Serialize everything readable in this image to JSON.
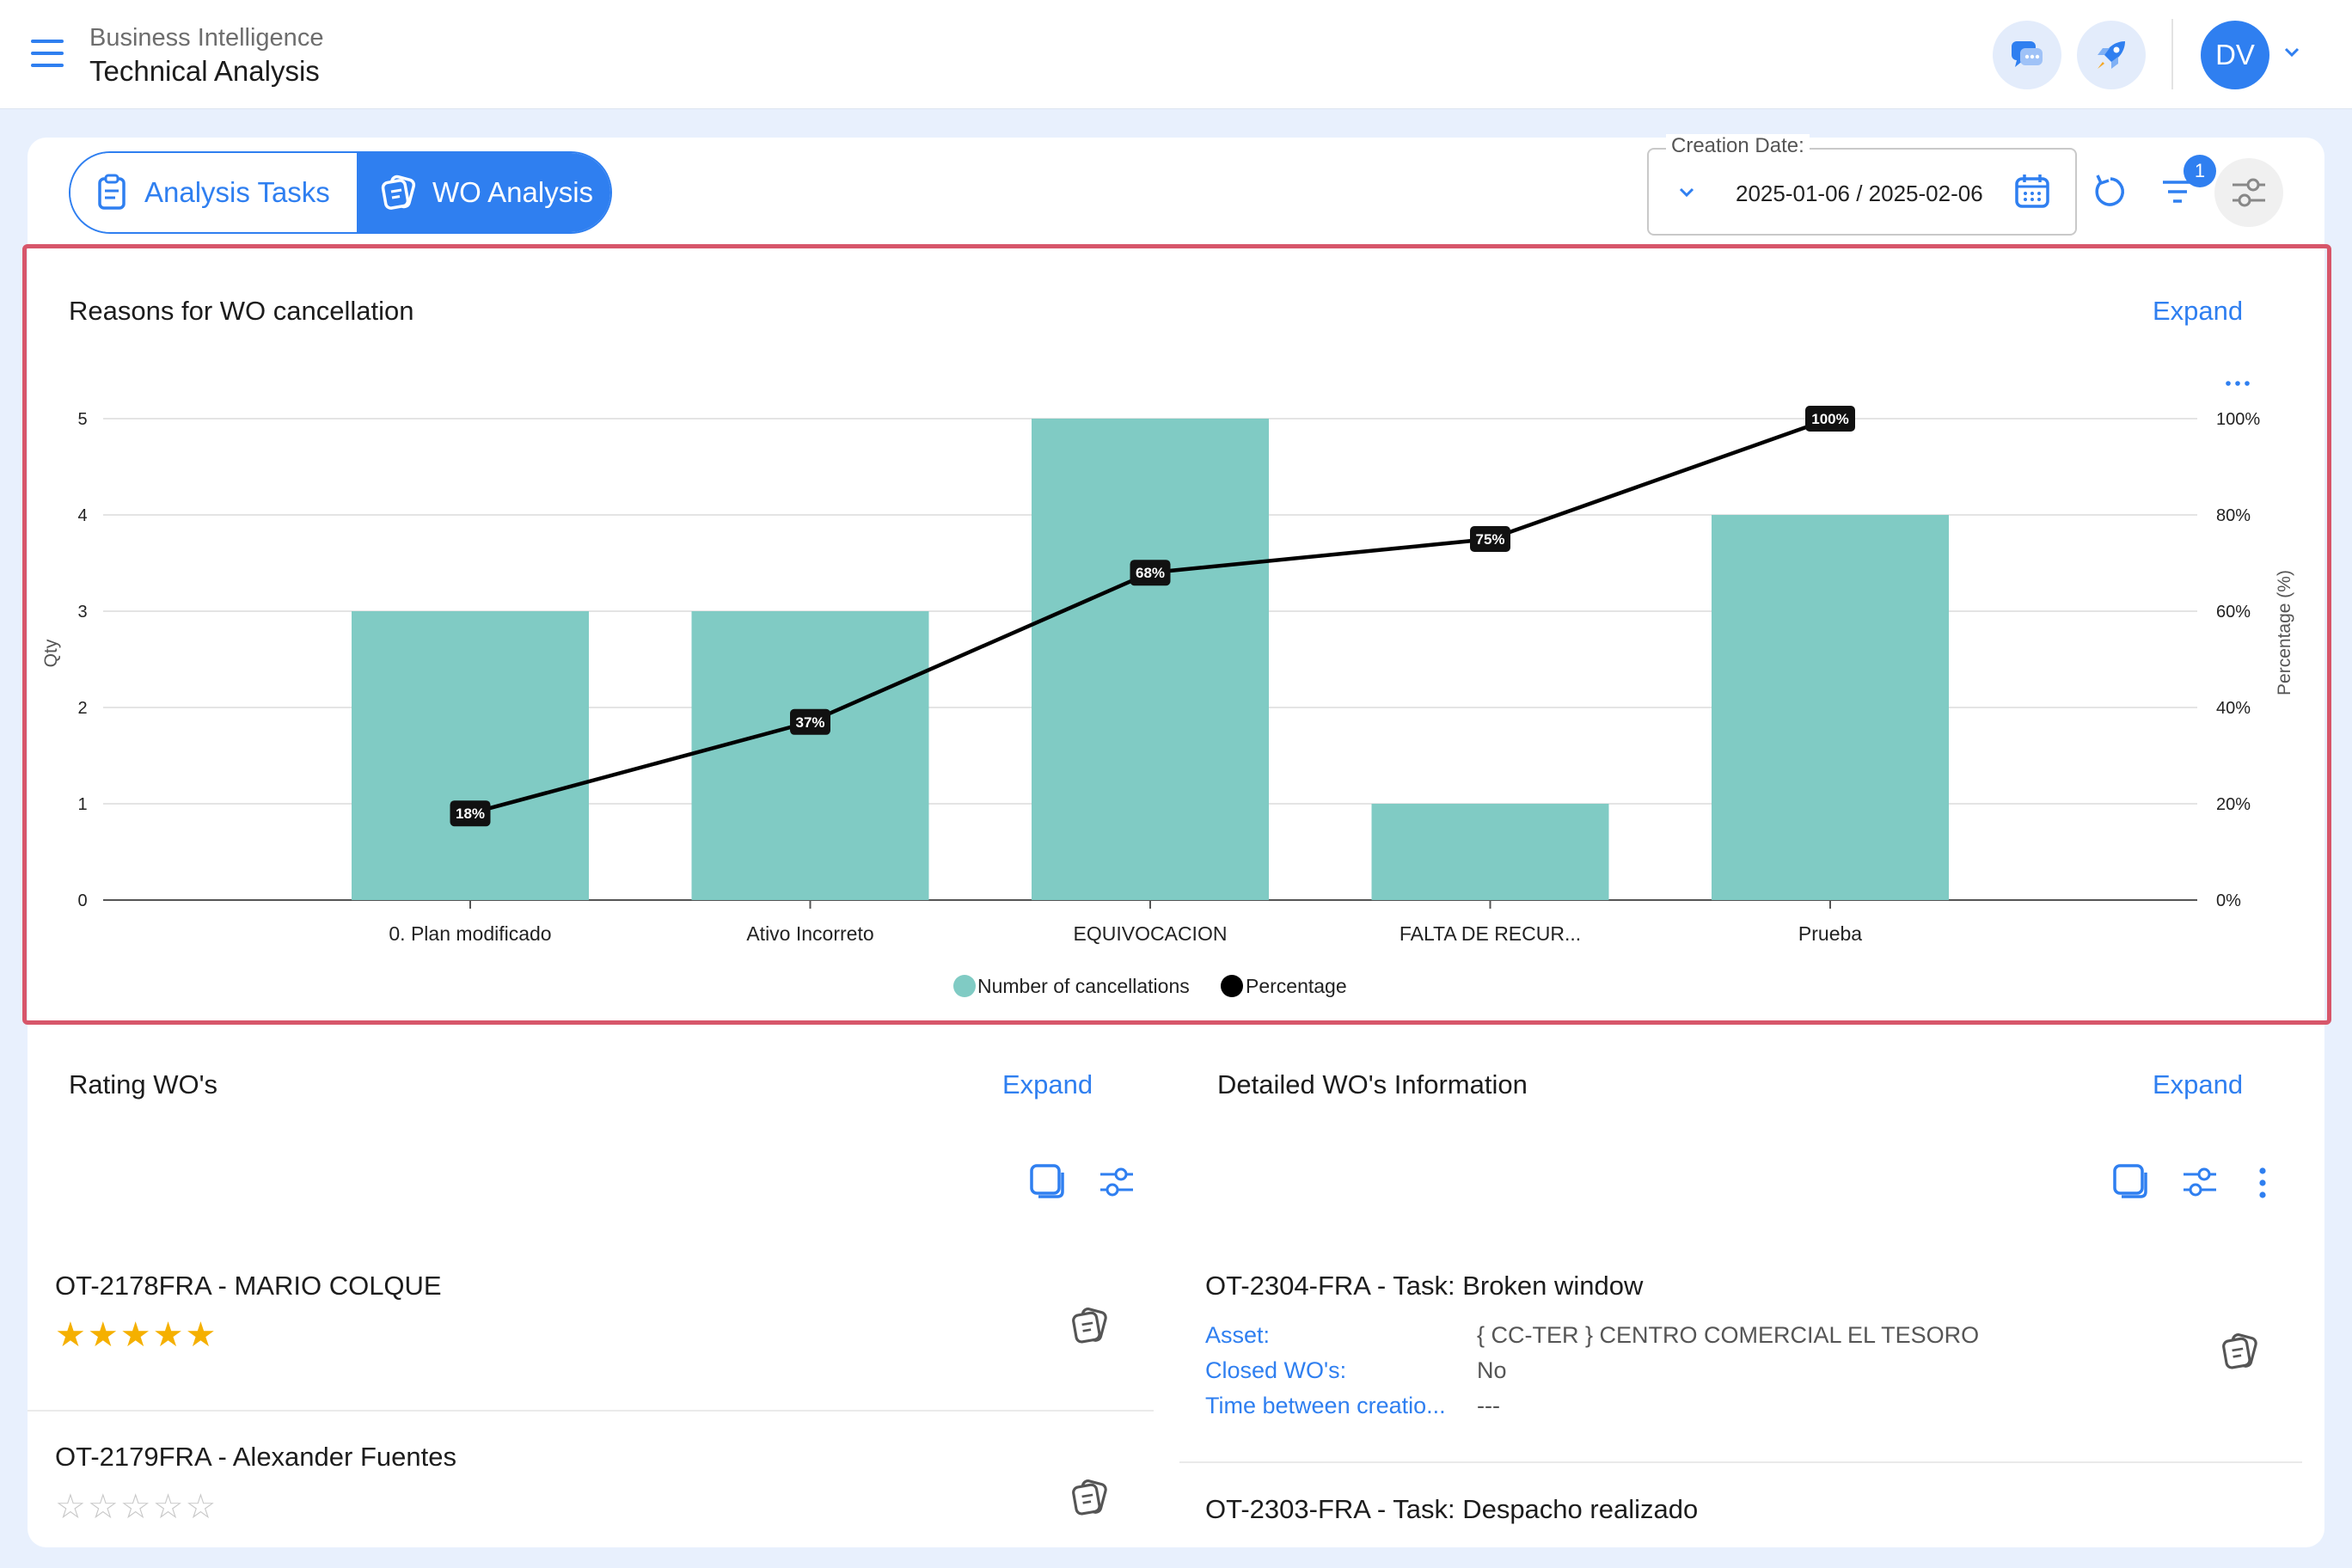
{
  "header": {
    "breadcrumb_parent": "Business Intelligence",
    "breadcrumb_current": "Technical Analysis",
    "avatar_initials": "DV"
  },
  "tabs": [
    {
      "label": "Analysis Tasks",
      "active": false
    },
    {
      "label": "WO Analysis",
      "active": true
    }
  ],
  "date_filter": {
    "label": "Creation Date:",
    "value": "2025-01-06 / 2025-02-06"
  },
  "filter_badge_count": "1",
  "chart_card": {
    "title": "Reasons for WO cancellation",
    "expand_label": "Expand",
    "more_icon": "ellipsis-icon"
  },
  "chart_data": {
    "type": "bar",
    "categories": [
      "0. Plan modificado",
      "Ativo Incorreto",
      "EQUIVOCACION",
      "FALTA DE RECUR...",
      "Prueba"
    ],
    "series": [
      {
        "name": "Number of cancellations",
        "type": "bar",
        "values": [
          3,
          3,
          5,
          1,
          4
        ],
        "color": "#80cbc4",
        "axis": "left"
      },
      {
        "name": "Percentage",
        "type": "line",
        "values": [
          18,
          37,
          68,
          75,
          100
        ],
        "labels": [
          "18%",
          "37%",
          "68%",
          "75%",
          "100%"
        ],
        "color": "#000000",
        "axis": "right"
      }
    ],
    "ylabel": "Qty",
    "y2label": "Percentage (%)",
    "ylim": [
      0,
      5
    ],
    "y2lim": [
      0,
      100
    ],
    "yticks": [
      "0",
      "1",
      "2",
      "3",
      "4",
      "5"
    ],
    "y2ticks": [
      "0%",
      "20%",
      "40%",
      "60%",
      "80%",
      "100%"
    ],
    "grid": true,
    "legend_position": "bottom"
  },
  "rating_card": {
    "title": "Rating WO's",
    "expand_label": "Expand",
    "items": [
      {
        "title": "OT-2178FRA - MARIO COLQUE",
        "rating": 5
      },
      {
        "title": "OT-2179FRA - Alexander Fuentes",
        "rating": 0
      }
    ]
  },
  "detail_card": {
    "title": "Detailed WO's Information",
    "expand_label": "Expand",
    "items": [
      {
        "title": "OT-2304-FRA - Task: Broken window",
        "fields": [
          {
            "key": "Asset:",
            "value": "{ CC-TER } CENTRO COMERCIAL EL TESORO"
          },
          {
            "key": "Closed WO's:",
            "value": "No"
          },
          {
            "key": "Time between creatio...",
            "value": "---"
          }
        ]
      },
      {
        "title": "OT-2303-FRA - Task: Despacho realizado"
      }
    ]
  }
}
